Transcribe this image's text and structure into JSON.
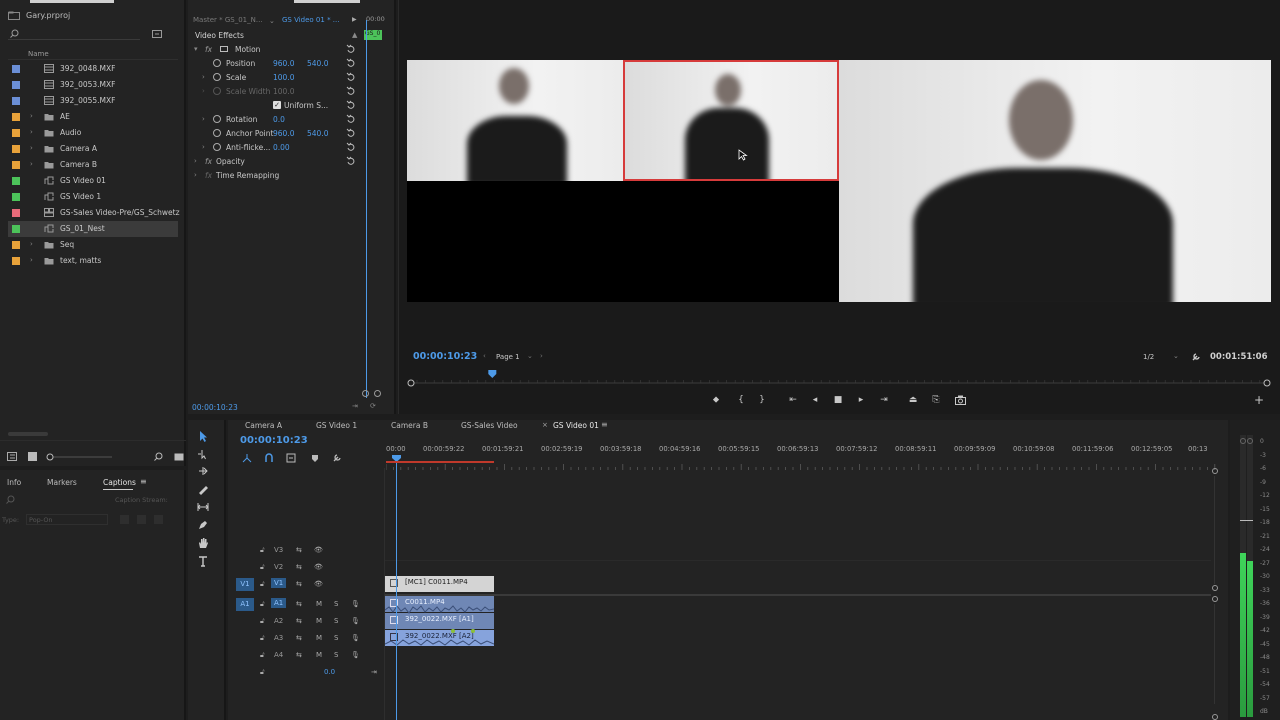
{
  "project": {
    "file_name": "Gary.prproj",
    "column_name": "Name",
    "items": [
      {
        "label": "392_0048.MXF",
        "color": "#6b8fd6",
        "kind": "clip",
        "expandable": false,
        "selected": false
      },
      {
        "label": "392_0053.MXF",
        "color": "#6b8fd6",
        "kind": "clip",
        "expandable": false,
        "selected": false
      },
      {
        "label": "392_0055.MXF",
        "color": "#6b8fd6",
        "kind": "clip",
        "expandable": false,
        "selected": false
      },
      {
        "label": "AE",
        "color": "#e8a23a",
        "kind": "folder",
        "expandable": true,
        "selected": false
      },
      {
        "label": "Audio",
        "color": "#e8a23a",
        "kind": "folder",
        "expandable": true,
        "selected": false
      },
      {
        "label": "Camera A",
        "color": "#e8a23a",
        "kind": "folder",
        "expandable": true,
        "selected": false
      },
      {
        "label": "Camera B",
        "color": "#e8a23a",
        "kind": "folder",
        "expandable": true,
        "selected": false
      },
      {
        "label": "GS Video 01",
        "color": "#4cc35a",
        "kind": "sequence",
        "expandable": false,
        "selected": false
      },
      {
        "label": "GS Video 1",
        "color": "#4cc35a",
        "kind": "sequence",
        "expandable": false,
        "selected": false
      },
      {
        "label": "GS-Sales Video-Pre/GS_Schwetz",
        "color": "#e86b7a",
        "kind": "multicam",
        "expandable": false,
        "selected": false
      },
      {
        "label": "GS_01_Nest",
        "color": "#4cc35a",
        "kind": "sequence",
        "expandable": false,
        "selected": true
      },
      {
        "label": "Seq",
        "color": "#e8a23a",
        "kind": "folder",
        "expandable": true,
        "selected": false
      },
      {
        "label": "text, matts",
        "color": "#e8a23a",
        "kind": "folder",
        "expandable": true,
        "selected": false
      }
    ]
  },
  "effect_controls": {
    "tab_master": "Master * GS_01_N...",
    "tab_sequence": "GS Video 01 * ...",
    "mini_timecode": "00:00",
    "mini_clip": "GS_0",
    "section_title": "Video Effects",
    "motion": "Motion",
    "position_label": "Position",
    "position_x": "960.0",
    "position_y": "540.0",
    "scale_label": "Scale",
    "scale_value": "100.0",
    "scale_width_label": "Scale Width",
    "scale_width_value": "100.0",
    "uniform_scale_label": "Uniform S...",
    "rotation_label": "Rotation",
    "rotation_value": "0.0",
    "anchor_label": "Anchor Point",
    "anchor_x": "960.0",
    "anchor_y": "540.0",
    "antiflicker_label": "Anti-flicke...",
    "antiflicker_value": "0.00",
    "opacity_label": "Opacity",
    "time_remap_label": "Time Remapping",
    "footer_timecode": "00:00:10:23"
  },
  "program": {
    "timecode": "00:00:10:23",
    "page_label": "Page 1",
    "resolution": "1/2",
    "duration": "00:01:51:06",
    "playhead_fraction": 0.095
  },
  "info_panel": {
    "tabs": [
      "Info",
      "Markers",
      "Captions"
    ],
    "active_tab": "Captions",
    "caption_stream_label": "Caption Stream:",
    "type_label": "Type:",
    "type_value": "Pop-On"
  },
  "timeline": {
    "tabs": [
      "Camera A",
      "GS Video 1",
      "Camera B",
      "GS-Sales Video",
      "GS Video 01"
    ],
    "active_tab": "GS Video 01",
    "timecode": "00:00:10:23",
    "ruler_labels": [
      "00:00",
      "00:00:59:22",
      "00:01:59:21",
      "00:02:59:19",
      "00:03:59:18",
      "00:04:59:16",
      "00:05:59:15",
      "00:06:59:13",
      "00:07:59:12",
      "00:08:59:11",
      "00:09:59:09",
      "00:10:59:08",
      "00:11:59:06",
      "00:12:59:05",
      "00:13"
    ],
    "tracks": [
      {
        "source": "",
        "name": "V3",
        "kind": "video"
      },
      {
        "source": "",
        "name": "V2",
        "kind": "video"
      },
      {
        "source": "V1",
        "name": "V1",
        "kind": "video"
      },
      {
        "source": "A1",
        "name": "A1",
        "kind": "audio"
      },
      {
        "source": "",
        "name": "A2",
        "kind": "audio"
      },
      {
        "source": "",
        "name": "A3",
        "kind": "audio"
      },
      {
        "source": "",
        "name": "A4",
        "kind": "audio"
      }
    ],
    "master_value": "0.0",
    "clips": {
      "v1": "[MC1] C0011.MP4",
      "a1": "C0011.MP4",
      "a2": "392_0022.MXF [A1]",
      "a3": "392_0022.MXF [A2]"
    }
  },
  "meter": {
    "scale": [
      "0",
      "-3",
      "-6",
      "-9",
      "-12",
      "-15",
      "-18",
      "-21",
      "-24",
      "-27",
      "-30",
      "-33",
      "-36",
      "-39",
      "-42",
      "-45",
      "-48",
      "-51",
      "-54",
      "-57",
      "dB"
    ]
  },
  "colors": {
    "accent": "#4d9ae8",
    "selection_red": "#d63b3b",
    "video_clip": "#c9c9c9",
    "audio_clip": "#7d9ed6"
  }
}
